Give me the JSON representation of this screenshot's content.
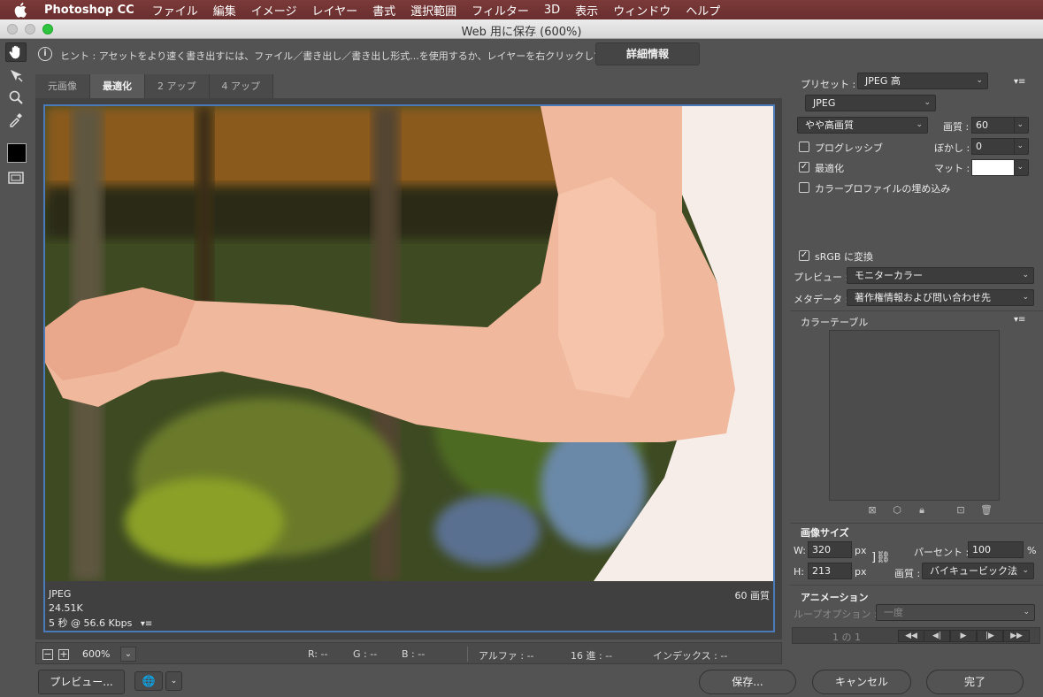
{
  "menubar": {
    "app": "Photoshop CC",
    "items": [
      "ファイル",
      "編集",
      "イメージ",
      "レイヤー",
      "書式",
      "選択範囲",
      "フィルター",
      "3D",
      "表示",
      "ウィンドウ",
      "ヘルプ"
    ]
  },
  "window": {
    "title": "Web 用に保存 (600%)"
  },
  "hint": {
    "text": "ヒント : アセットをより速く書き出すには、ファイル／書き出し／書き出し形式...を使用するか、レイヤーを右クリックして使用。",
    "detail_button": "詳細情報"
  },
  "tabs": [
    {
      "label": "元画像",
      "active": false
    },
    {
      "label": "最適化",
      "active": true
    },
    {
      "label": "2 アップ",
      "active": false
    },
    {
      "label": "4 アップ",
      "active": false
    }
  ],
  "preview_info": {
    "format": "JPEG",
    "size": "24.51K",
    "time": "5 秒 @ 56.6 Kbps",
    "quality": "60 画質"
  },
  "status": {
    "zoom": "600%",
    "r": "R: --",
    "g": "G : --",
    "b": "B : --",
    "alpha": "アルファ : --",
    "hex": "16 進 : --",
    "index": "インデックス : --"
  },
  "buttons": {
    "preview": "プレビュー...",
    "save": "保存...",
    "cancel": "キャンセル",
    "done": "完了"
  },
  "settings": {
    "preset_label": "プリセット :",
    "preset_value": "JPEG 高",
    "format": "JPEG",
    "quality_preset": "やや高画質",
    "quality_label": "画質 :",
    "quality_value": "60",
    "progressive": "プログレッシブ",
    "progressive_checked": false,
    "blur_label": "ぼかし :",
    "blur_value": "0",
    "optimized": "最適化",
    "optimized_checked": true,
    "matte_label": "マット :",
    "embed_profile": "カラープロファイルの埋め込み",
    "embed_profile_checked": false,
    "srgb": "sRGB に変換",
    "srgb_checked": true,
    "preview_label": "プレビュー :",
    "preview_value": "モニターカラー",
    "metadata_label": "メタデータ :",
    "metadata_value": "著作権情報および問い合わせ先",
    "color_table_title": "カラーテーブル"
  },
  "image_size": {
    "title": "画像サイズ",
    "w_label": "W:",
    "w_value": "320",
    "h_label": "H:",
    "h_value": "213",
    "unit": "px",
    "percent_label": "パーセント :",
    "percent_value": "100",
    "percent_unit": "%",
    "quality_label": "画質 :",
    "quality_value": "バイキュービック法"
  },
  "animation": {
    "title": "アニメーション",
    "loop_label": "ループオプション :",
    "loop_value": "一度",
    "frame": "1 の 1"
  },
  "colors": {
    "menubar": "#6f3332",
    "selection_border": "#4a7ab8",
    "traffic_green": "#2ec43d"
  }
}
